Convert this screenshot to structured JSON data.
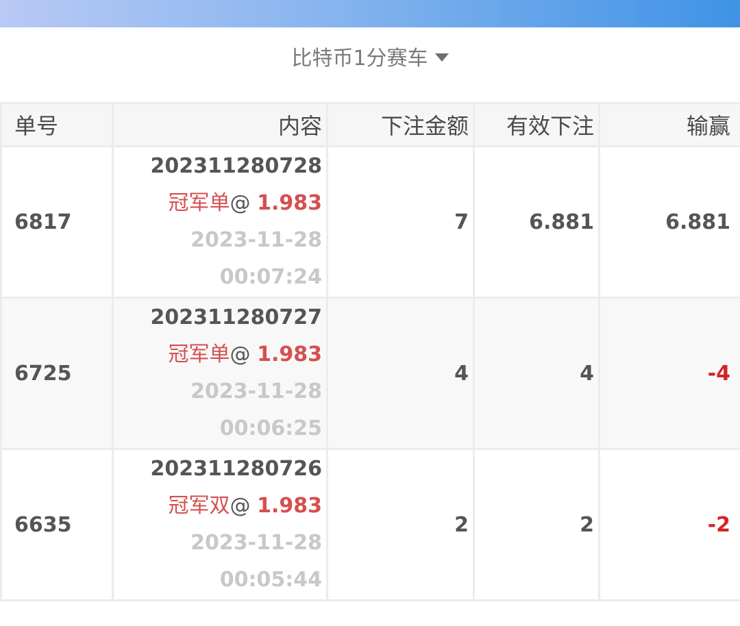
{
  "header": {
    "lottery_name": "比特币1分赛车"
  },
  "table": {
    "headers": [
      "单号",
      "内容",
      "下注金额",
      "有效下注",
      "输赢"
    ],
    "rows": [
      {
        "id": "6817",
        "issue": "202311280728",
        "bet": "冠军单",
        "at": "@ ",
        "odds": "1.983",
        "date": "2023-11-28",
        "time": "00:07:24",
        "amount": "7",
        "valid": "6.881",
        "result": "6.881"
      },
      {
        "id": "6725",
        "issue": "202311280727",
        "bet": "冠军单",
        "at": "@ ",
        "odds": "1.983",
        "date": "2023-11-28",
        "time": "00:06:25",
        "amount": "4",
        "valid": "4",
        "result": "-4"
      },
      {
        "id": "6635",
        "issue": "202311280726",
        "bet": "冠军双",
        "at": "@ ",
        "odds": "1.983",
        "date": "2023-11-28",
        "time": "00:05:44",
        "amount": "2",
        "valid": "2",
        "result": "-2"
      }
    ]
  }
}
